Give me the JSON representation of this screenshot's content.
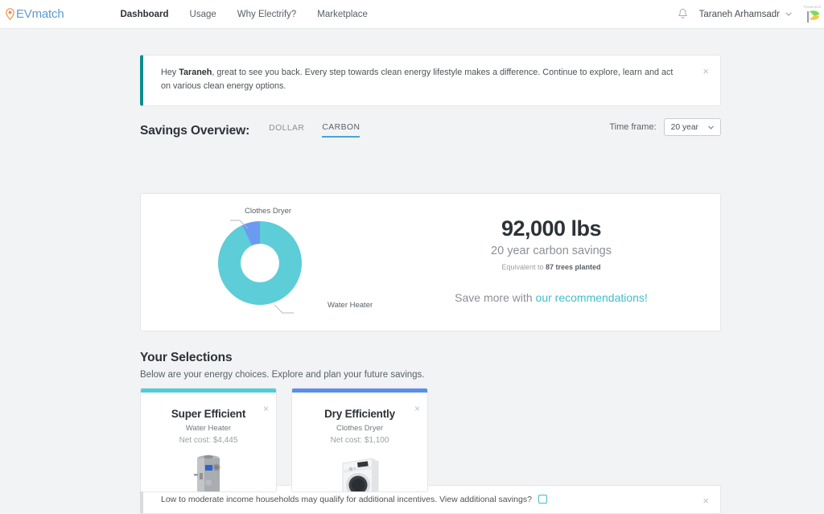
{
  "header": {
    "logo_text": "EVmatch",
    "logo_pin_color": "#f2883c",
    "logo_text_color": "#5b9bd5",
    "nav": [
      {
        "label": "Dashboard",
        "active": true
      },
      {
        "label": "Usage",
        "active": false
      },
      {
        "label": "Why Electrify?",
        "active": false
      },
      {
        "label": "Marketplace",
        "active": false
      }
    ],
    "bell_icon": "bell-icon",
    "user_name": "Taraneh Arhamsadr",
    "chevron_icon": "chevron-down-icon"
  },
  "greeting_banner": {
    "text_prefix": "Hey ",
    "name": "Taraneh",
    "text_rest": ", great to see you back. Every step towards clean energy lifestyle makes a difference. Continue to explore, learn and act on various clean energy options.",
    "close_label": "×",
    "accent_color": "#0d8d8d"
  },
  "savings": {
    "title": "Savings Overview:",
    "tabs": [
      {
        "label": "DOLLAR",
        "active": false
      },
      {
        "label": "CARBON",
        "active": true
      }
    ],
    "timeframe_label": "Time frame:",
    "timeframe_value": "20 year",
    "stat_value": "92,000 lbs",
    "stat_subtitle": "20 year carbon savings",
    "equivalent_prefix": "Equivalent to ",
    "equivalent_value": "87 trees planted",
    "cta_prefix": "Save more with ",
    "cta_link": "our recommendations!",
    "cta_link_color": "#3fbfc9"
  },
  "chart_data": {
    "type": "pie",
    "title": "",
    "variant": "donut",
    "categories": [
      "Water Heater",
      "Clothes Dryer"
    ],
    "values": [
      93,
      7
    ],
    "unit": "%",
    "colors": [
      "#5dcdd8",
      "#6b9bf0"
    ],
    "labels_position": "outside-leader-lines",
    "legend": "none",
    "inner_radius_ratio": 0.46
  },
  "incentive_banner": {
    "text": "Low to moderate income households may qualify for additional incentives. View additional savings?",
    "checkbox_checked": false,
    "checkbox_color": "#3fbfc9",
    "close_label": "×"
  },
  "selections": {
    "title": "Your Selections",
    "subtitle": "Below are your energy choices. Explore and plan your future savings.",
    "cards": [
      {
        "title": "Super Efficient",
        "subtitle": "Water Heater",
        "cost": "Net cost: $4,445",
        "bar_color": "#4ecdd6",
        "image": "water-heater-image",
        "close_label": "×"
      },
      {
        "title": "Dry Efficiently",
        "subtitle": "Clothes Dryer",
        "cost": "Net cost: $1,100",
        "bar_color": "#5b8def",
        "image": "clothes-dryer-image",
        "close_label": "×"
      }
    ]
  }
}
